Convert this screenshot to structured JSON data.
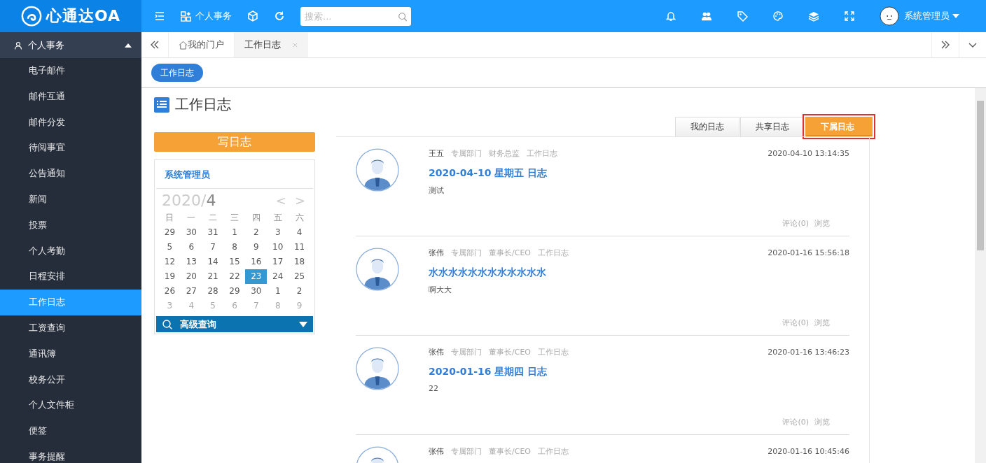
{
  "header": {
    "logo": "心通达OA",
    "module": "个人事务",
    "search": {
      "placeholder": "搜索..."
    },
    "user": "系统管理员"
  },
  "sidebar": {
    "group": {
      "label": "个人事务",
      "expanded": true
    },
    "items": [
      {
        "label": "电子邮件",
        "selected": false
      },
      {
        "label": "邮件互通",
        "selected": false
      },
      {
        "label": "邮件分发",
        "selected": false
      },
      {
        "label": "待阅事宜",
        "selected": false
      },
      {
        "label": "公告通知",
        "selected": false
      },
      {
        "label": "新闻",
        "selected": false
      },
      {
        "label": "投票",
        "selected": false
      },
      {
        "label": "个人考勤",
        "selected": false
      },
      {
        "label": "日程安排",
        "selected": false
      },
      {
        "label": "工作日志",
        "selected": true
      },
      {
        "label": "工资查询",
        "selected": false
      },
      {
        "label": "通讯簿",
        "selected": false
      },
      {
        "label": "校务公开",
        "selected": false
      },
      {
        "label": "个人文件柜",
        "selected": false
      },
      {
        "label": "便签",
        "selected": false
      },
      {
        "label": "事务提醒",
        "selected": false
      }
    ]
  },
  "page_tabs": [
    {
      "label": "我的门户",
      "kind": "home",
      "selected": false
    },
    {
      "label": "工作日志",
      "kind": "closable",
      "selected": true
    }
  ],
  "breadcrumb": "工作日志",
  "page_title": "工作日志",
  "write_button": "写日志",
  "calendar": {
    "owner": "系统管理员",
    "year": "2020/",
    "month": "4",
    "prev": "<",
    "next": ">",
    "weekdays": [
      "日",
      "一",
      "二",
      "三",
      "四",
      "五",
      "六"
    ],
    "weeks": [
      [
        {
          "d": "29",
          "muted": false,
          "selected": false
        },
        {
          "d": "30",
          "muted": false,
          "selected": false
        },
        {
          "d": "31",
          "muted": false,
          "selected": false
        },
        {
          "d": "1",
          "muted": false,
          "selected": false
        },
        {
          "d": "2",
          "muted": false,
          "selected": false
        },
        {
          "d": "3",
          "muted": false,
          "selected": false
        },
        {
          "d": "4",
          "muted": false,
          "selected": false
        }
      ],
      [
        {
          "d": "5",
          "muted": false,
          "selected": false
        },
        {
          "d": "6",
          "muted": false,
          "selected": false
        },
        {
          "d": "7",
          "muted": false,
          "selected": false
        },
        {
          "d": "8",
          "muted": false,
          "selected": false
        },
        {
          "d": "9",
          "muted": false,
          "selected": false
        },
        {
          "d": "10",
          "muted": false,
          "selected": false
        },
        {
          "d": "11",
          "muted": false,
          "selected": false
        }
      ],
      [
        {
          "d": "12",
          "muted": false,
          "selected": false
        },
        {
          "d": "13",
          "muted": false,
          "selected": false
        },
        {
          "d": "14",
          "muted": false,
          "selected": false
        },
        {
          "d": "15",
          "muted": false,
          "selected": false
        },
        {
          "d": "16",
          "muted": false,
          "selected": false
        },
        {
          "d": "17",
          "muted": false,
          "selected": false
        },
        {
          "d": "18",
          "muted": false,
          "selected": false
        }
      ],
      [
        {
          "d": "19",
          "muted": false,
          "selected": false
        },
        {
          "d": "20",
          "muted": false,
          "selected": false
        },
        {
          "d": "21",
          "muted": false,
          "selected": false
        },
        {
          "d": "22",
          "muted": false,
          "selected": false
        },
        {
          "d": "23",
          "muted": false,
          "selected": true
        },
        {
          "d": "24",
          "muted": false,
          "selected": false
        },
        {
          "d": "25",
          "muted": false,
          "selected": false
        }
      ],
      [
        {
          "d": "26",
          "muted": false,
          "selected": false
        },
        {
          "d": "27",
          "muted": false,
          "selected": false
        },
        {
          "d": "28",
          "muted": false,
          "selected": false
        },
        {
          "d": "29",
          "muted": false,
          "selected": false
        },
        {
          "d": "30",
          "muted": false,
          "selected": false
        },
        {
          "d": "1",
          "muted": false,
          "selected": false
        },
        {
          "d": "2",
          "muted": false,
          "selected": false
        }
      ],
      [
        {
          "d": "3",
          "muted": true,
          "selected": false
        },
        {
          "d": "4",
          "muted": true,
          "selected": false
        },
        {
          "d": "5",
          "muted": true,
          "selected": false
        },
        {
          "d": "6",
          "muted": true,
          "selected": false
        },
        {
          "d": "7",
          "muted": true,
          "selected": false
        },
        {
          "d": "8",
          "muted": true,
          "selected": false
        },
        {
          "d": "9",
          "muted": true,
          "selected": false
        }
      ]
    ],
    "search_bar": "高级查询"
  },
  "log_tabs": [
    {
      "label": "我的日志",
      "selected": false
    },
    {
      "label": "共享日志",
      "selected": false
    },
    {
      "label": "下属日志",
      "selected": true
    }
  ],
  "entries": [
    {
      "author": "王五",
      "meta": [
        "专属部门",
        "财务总监",
        "工作日志"
      ],
      "time": "2020-04-10 13:14:35",
      "title": "2020-04-10 星期五 日志",
      "body": "测试",
      "comments": "评论(0)",
      "view": "浏览"
    },
    {
      "author": "张伟",
      "meta": [
        "专属部门",
        "董事长/CEO",
        "工作日志"
      ],
      "time": "2020-01-16 15:56:18",
      "title": "水水水水水水水水水水水水",
      "body": "啊大大",
      "comments": "评论(0)",
      "view": "浏览"
    },
    {
      "author": "张伟",
      "meta": [
        "专属部门",
        "董事长/CEO",
        "工作日志"
      ],
      "time": "2020-01-16 13:46:23",
      "title": "2020-01-16 星期四 日志",
      "body": "22",
      "comments": "评论(0)",
      "view": "浏览"
    },
    {
      "author": "张伟",
      "meta": [
        "专属部门",
        "董事长/CEO",
        "工作日志"
      ],
      "time": "2020-01-16 10:45:46"
    }
  ]
}
